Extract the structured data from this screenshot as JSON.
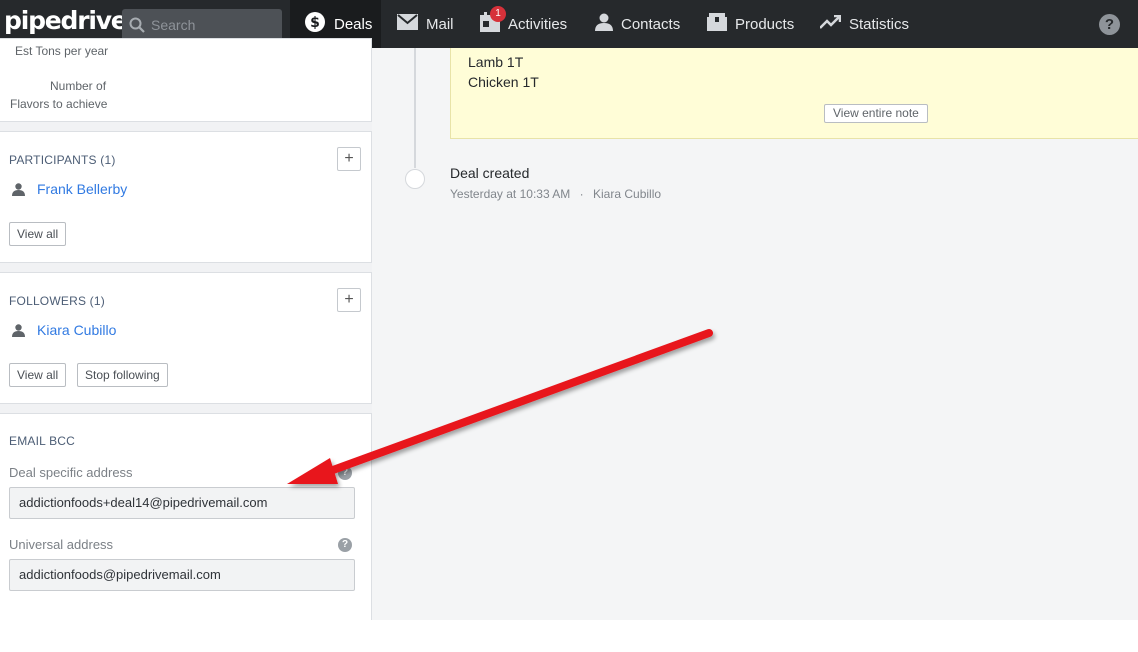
{
  "nav": {
    "logo": "pipedrive",
    "search_placeholder": "Search",
    "items": [
      {
        "label": "Deals",
        "icon": "dollar-icon"
      },
      {
        "label": "Mail",
        "icon": "mail-icon"
      },
      {
        "label": "Activities",
        "icon": "calendar-icon",
        "badge": "1"
      },
      {
        "label": "Contacts",
        "icon": "person-icon"
      },
      {
        "label": "Products",
        "icon": "box-icon"
      },
      {
        "label": "Statistics",
        "icon": "chart-icon"
      }
    ],
    "help": "?"
  },
  "details": {
    "est_tons": "Est Tons per year",
    "flavors_line1": "Number of",
    "flavors_line2": "Flavors to achieve"
  },
  "participants": {
    "title": "PARTICIPANTS (1)",
    "person": "Frank Bellerby",
    "view_all": "View all"
  },
  "followers": {
    "title": "FOLLOWERS (1)",
    "person": "Kiara Cubillo",
    "view_all": "View all",
    "stop_following": "Stop following"
  },
  "email_bcc": {
    "title": "EMAIL BCC",
    "deal_specific_label": "Deal specific address",
    "deal_specific_value": "addictionfoods+deal14@pipedrivemail.com",
    "universal_label": "Universal address",
    "universal_value": "addictionfoods@pipedrivemail.com"
  },
  "note": {
    "line1": "Lamb 1T",
    "line2": "Chicken 1T",
    "view_entire": "View entire note"
  },
  "timeline": {
    "event": "Deal created",
    "time": "Yesterday at 10:33 AM",
    "separator": "·",
    "user": "Kiara Cubillo"
  },
  "colors": {
    "nav_bg": "#26292c",
    "link": "#317ae2",
    "note_bg": "#fffdd7",
    "arrow": "#e8141b"
  }
}
